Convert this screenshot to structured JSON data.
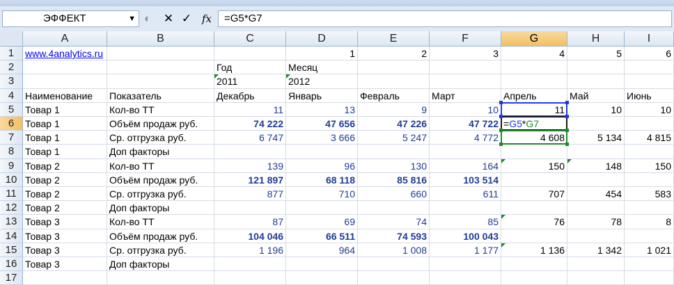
{
  "name_box": {
    "value": "ЭФФЕКТ"
  },
  "formula_bar": {
    "cancel_icon": "✕",
    "enter_icon": "✓",
    "fx_label": "fx",
    "formula": "=G5*G7"
  },
  "columns": [
    "A",
    "B",
    "C",
    "D",
    "E",
    "F",
    "G",
    "H",
    "I"
  ],
  "rows": [
    {
      "num": "1",
      "cells": {
        "A": "www.4analytics.ru",
        "D": "1",
        "E": "2",
        "F": "3",
        "G": "4",
        "H": "5",
        "I": "6"
      }
    },
    {
      "num": "2",
      "cells": {
        "C": "Год",
        "D": "Месяц"
      }
    },
    {
      "num": "3",
      "cells": {
        "C": "2011",
        "D": "2012"
      }
    },
    {
      "num": "4",
      "cells": {
        "A": "Наименование",
        "B": "Показатель",
        "C": "Декабрь",
        "D": "Январь",
        "E": "Февраль",
        "F": "Март",
        "G": "Апрель",
        "H": "Май",
        "I": "Июнь"
      }
    },
    {
      "num": "5",
      "cells": {
        "A": "Товар 1",
        "B": "Кол-во ТТ",
        "C": "11",
        "D": "13",
        "E": "9",
        "F": "10",
        "G": "11",
        "H": "10",
        "I": "10"
      }
    },
    {
      "num": "6",
      "cells": {
        "A": "Товар 1",
        "B": "Объём продаж руб.",
        "C": "74 222",
        "D": "47 656",
        "E": "47 226",
        "F": "47 722",
        "G": "=G5*G7"
      }
    },
    {
      "num": "7",
      "cells": {
        "A": "Товар 1",
        "B": "Ср. отгрузка руб.",
        "C": "6 747",
        "D": "3 666",
        "E": "5 247",
        "F": "4 772",
        "G": "4 608",
        "H": "5 134",
        "I": "4 815"
      }
    },
    {
      "num": "8",
      "cells": {
        "A": "Товар 1",
        "B": "Доп факторы"
      }
    },
    {
      "num": "9",
      "cells": {
        "A": "Товар 2",
        "B": "Кол-во ТТ",
        "C": "139",
        "D": "96",
        "E": "130",
        "F": "164",
        "G": "150",
        "H": "148",
        "I": "150"
      }
    },
    {
      "num": "10",
      "cells": {
        "A": "Товар 2",
        "B": "Объём продаж руб.",
        "C": "121 897",
        "D": "68 118",
        "E": "85 816",
        "F": "103 514"
      }
    },
    {
      "num": "11",
      "cells": {
        "A": "Товар 2",
        "B": "Ср. отгрузка руб.",
        "C": "877",
        "D": "710",
        "E": "660",
        "F": "611",
        "G": "707",
        "H": "454",
        "I": "583"
      }
    },
    {
      "num": "12",
      "cells": {
        "A": "Товар 2",
        "B": "Доп факторы"
      }
    },
    {
      "num": "13",
      "cells": {
        "A": "Товар 3",
        "B": "Кол-во ТТ",
        "C": "87",
        "D": "69",
        "E": "74",
        "F": "85",
        "G": "76",
        "H": "78",
        "I": "8"
      }
    },
    {
      "num": "14",
      "cells": {
        "A": "Товар 3",
        "B": "Объём продаж руб.",
        "C": "104 046",
        "D": "66 511",
        "E": "74 593",
        "F": "100 043"
      }
    },
    {
      "num": "15",
      "cells": {
        "A": "Товар 3",
        "B": "Ср. отгрузка руб.",
        "C": "1 196",
        "D": "964",
        "E": "1 008",
        "F": "1 177",
        "G": "1 136",
        "H": "1 342",
        "I": "1 021"
      }
    },
    {
      "num": "16",
      "cells": {
        "A": "Товар 3",
        "B": "Доп факторы"
      }
    },
    {
      "num": "17",
      "cells": {}
    }
  ],
  "colors": {
    "accent_selection": "#f1c15f",
    "data_blue": "#1f3b95",
    "formula_green": "#1f8a2b"
  }
}
